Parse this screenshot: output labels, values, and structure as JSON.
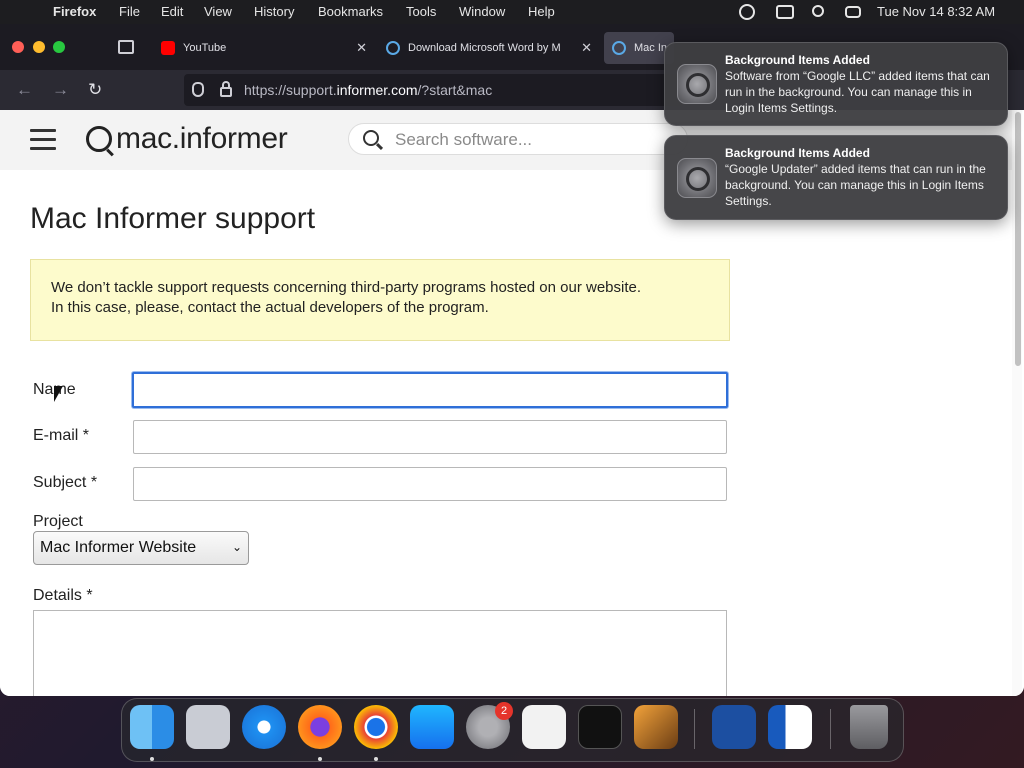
{
  "menubar": {
    "app": "Firefox",
    "menus": [
      "File",
      "Edit",
      "View",
      "History",
      "Bookmarks",
      "Tools",
      "Window",
      "Help"
    ],
    "clock": "Tue Nov 14  8:32 AM"
  },
  "tabs": [
    {
      "label": "YouTube"
    },
    {
      "label": "Download Microsoft Word by M"
    },
    {
      "label": "Mac In"
    }
  ],
  "address_bar": {
    "url_prefix": "https://support.",
    "url_domain": "informer.com",
    "url_suffix": "/?start&mac"
  },
  "site": {
    "logo": "mac.informer",
    "search_placeholder": "Search software..."
  },
  "page": {
    "title": "Mac Informer support",
    "notice_line1": "We don’t tackle support requests concerning third-party programs hosted on our website.",
    "notice_line2": "In this case, please, contact the actual developers of the program.",
    "form": {
      "name_label": "Name",
      "email_label": "E-mail *",
      "subject_label": "Subject *",
      "project_label": "Project",
      "project_value": "Mac Informer Website",
      "details_label": "Details *"
    }
  },
  "notifications": [
    {
      "title": "Background Items Added",
      "body": "Software from “Google LLC” added items that can run in the background. You can manage this in Login Items Settings."
    },
    {
      "title": "Background Items Added",
      "body": "“Google Updater” added items that can run in the background. You can manage this in Login Items Settings."
    }
  ],
  "dock": {
    "settings_badge": "2",
    "icons": [
      "finder-icon",
      "launchpad-icon",
      "safari-icon",
      "firefox-icon",
      "chrome-icon",
      "app-store-icon",
      "system-settings-icon",
      "textedit-icon",
      "terminal-icon",
      "garageband-icon",
      "mac-informer-icon",
      "word-icon",
      "trash-icon"
    ]
  },
  "colors": {
    "focus_ring": "#2f6fd8",
    "notice_bg": "#fdfbcc",
    "menubar_bg": "#1d1d20",
    "tab_bar_bg": "#1c1b22"
  }
}
